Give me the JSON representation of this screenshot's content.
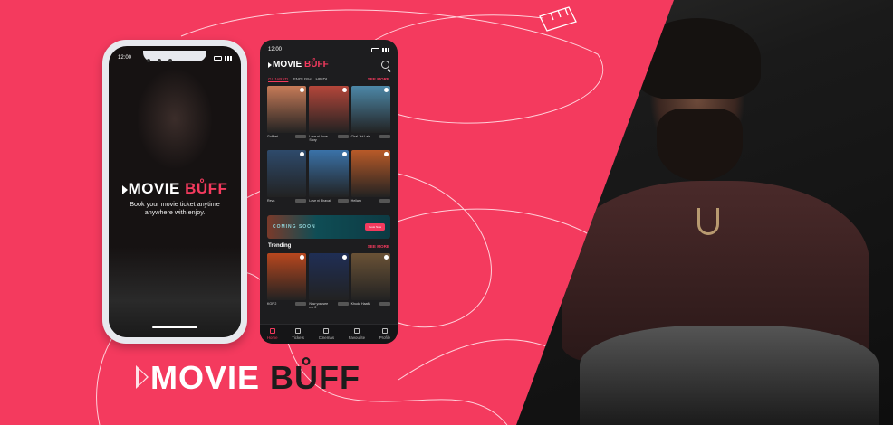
{
  "brand": {
    "movie": "MOVIE",
    "buff": "BŮFF",
    "tagline": "Book your movie ticket anytime anywhere with enjoy."
  },
  "colors": {
    "accent": "#f43a5e",
    "background": "#f43a5e",
    "dark": "#1d1d1f"
  },
  "splash": {
    "time": "12:00"
  },
  "app": {
    "time": "12:00",
    "languages": [
      "GUJARATI",
      "ENGLISH",
      "HINDI"
    ],
    "see_more": "SEE MORE",
    "movies": [
      {
        "title": "Gollkeri",
        "color": "#c77b58"
      },
      {
        "title": "Love ni Love Story",
        "color": "#b4463a"
      },
      {
        "title": "Chal Jivi Laie",
        "color": "#4d88a8"
      },
      {
        "title": "Reva",
        "color": "#2e4a6b"
      },
      {
        "title": "Love ni Bhavai",
        "color": "#3a72a8"
      },
      {
        "title": "Hellaro",
        "color": "#b85a28"
      }
    ],
    "banner": {
      "text": "COMING SOON",
      "button": "Book Now"
    },
    "trending_title": "Trending",
    "trending": [
      {
        "title": "KGF 2",
        "color": "#b8471e"
      },
      {
        "title": "Now you see me 2",
        "color": "#1f2e55"
      },
      {
        "title": "Khuda Haafiz",
        "color": "#6a5236"
      }
    ],
    "tabs": [
      {
        "label": "Home",
        "active": true
      },
      {
        "label": "Tickets",
        "active": false
      },
      {
        "label": "Cinemas",
        "active": false
      },
      {
        "label": "Favourite",
        "active": false
      },
      {
        "label": "Profile",
        "active": false
      }
    ]
  }
}
